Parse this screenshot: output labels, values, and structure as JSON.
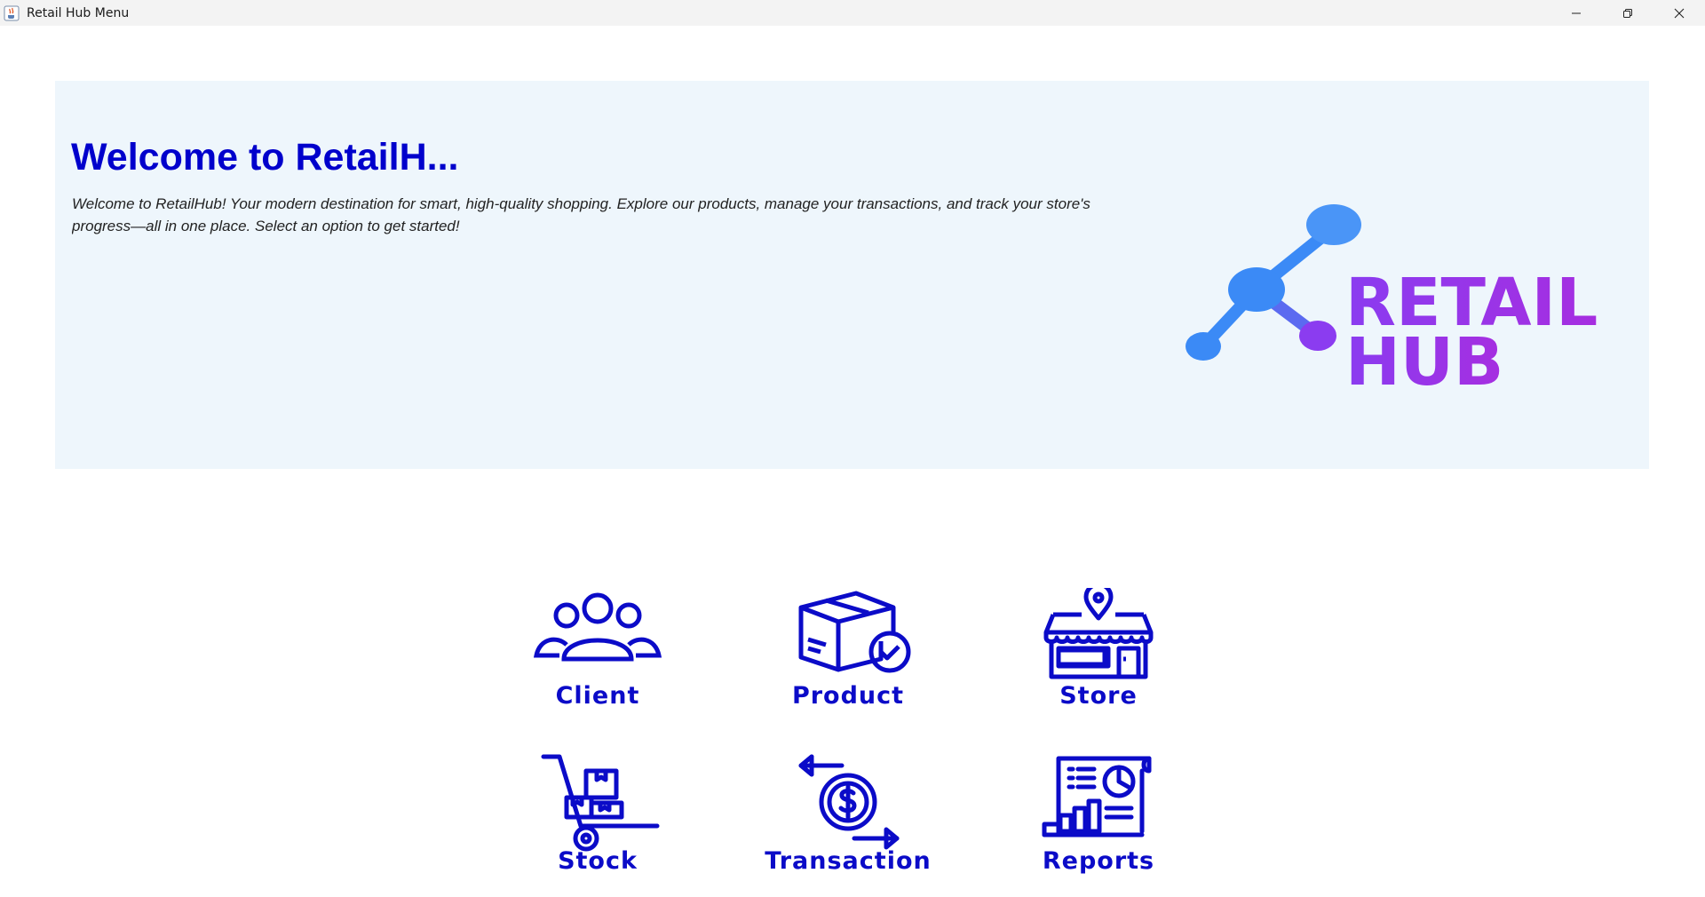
{
  "window": {
    "title": "Retail Hub Menu",
    "controls": [
      "minimize-icon",
      "restore-icon",
      "close-icon"
    ]
  },
  "header": {
    "title": "Welcome to RetailH...",
    "description": "Welcome to RetailHub! Your modern destination for smart, high-quality shopping. Explore our products, manage your transactions, and track your store's progress—all in one place. Select an option to get started!",
    "logo": {
      "line1": "RETAIL",
      "line2": "HUB",
      "gradient_start": "#3b82f6",
      "gradient_end": "#9b30e8"
    },
    "background": "#eef6fc",
    "title_color": "#0000cc"
  },
  "menu": {
    "accent": "#0b0bc8",
    "items": [
      {
        "label": "Client",
        "icon": "users-icon"
      },
      {
        "label": "Product",
        "icon": "package-check-icon"
      },
      {
        "label": "Store",
        "icon": "storefront-icon"
      },
      {
        "label": "Stock",
        "icon": "hand-truck-icon"
      },
      {
        "label": "Transaction",
        "icon": "money-exchange-icon"
      },
      {
        "label": "Reports",
        "icon": "report-icon"
      }
    ]
  }
}
